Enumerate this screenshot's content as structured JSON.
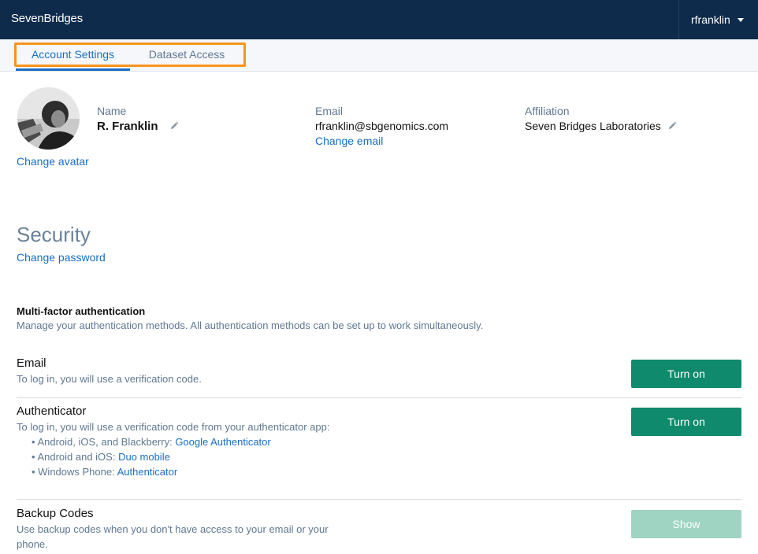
{
  "header": {
    "brand": "SevenBridges",
    "username": "rfranklin"
  },
  "tabs": [
    {
      "label": "Account Settings",
      "active": true
    },
    {
      "label": "Dataset Access",
      "active": false
    }
  ],
  "profile": {
    "change_avatar": "Change avatar",
    "name_label": "Name",
    "name_value": "R. Franklin",
    "email_label": "Email",
    "email_value": "rfranklin@sbgenomics.com",
    "change_email": "Change email",
    "affiliation_label": "Affiliation",
    "affiliation_value": "Seven Bridges Laboratories"
  },
  "security": {
    "title": "Security",
    "change_password": "Change password",
    "mfa_title": "Multi-factor authentication",
    "mfa_desc": "Manage your authentication methods. All authentication methods can be set up to work simultaneously.",
    "methods": [
      {
        "title": "Email",
        "desc": "To log in, you will use a verification code.",
        "button": "Turn on"
      },
      {
        "title": "Authenticator",
        "desc": "To log in, you will use a verification code from your authenticator app:",
        "button": "Turn on",
        "bullets": [
          {
            "platform": "• Android, iOS, and Blackberry: ",
            "app": "Google Authenticator"
          },
          {
            "platform": "• Android and iOS: ",
            "app": "Duo mobile"
          },
          {
            "platform": "• Windows Phone: ",
            "app": "Authenticator"
          }
        ]
      },
      {
        "title": "Backup Codes",
        "desc_line1": "Use backup codes when you don't have access to your email or your",
        "desc_line2": "phone.",
        "button": "Show"
      }
    ]
  },
  "colors": {
    "header_bg": "#0f2b4c",
    "link": "#1a6fc4",
    "primary_button": "#0f8a6c",
    "disabled_button": "#9fd3c2",
    "highlight": "#f7941d"
  }
}
